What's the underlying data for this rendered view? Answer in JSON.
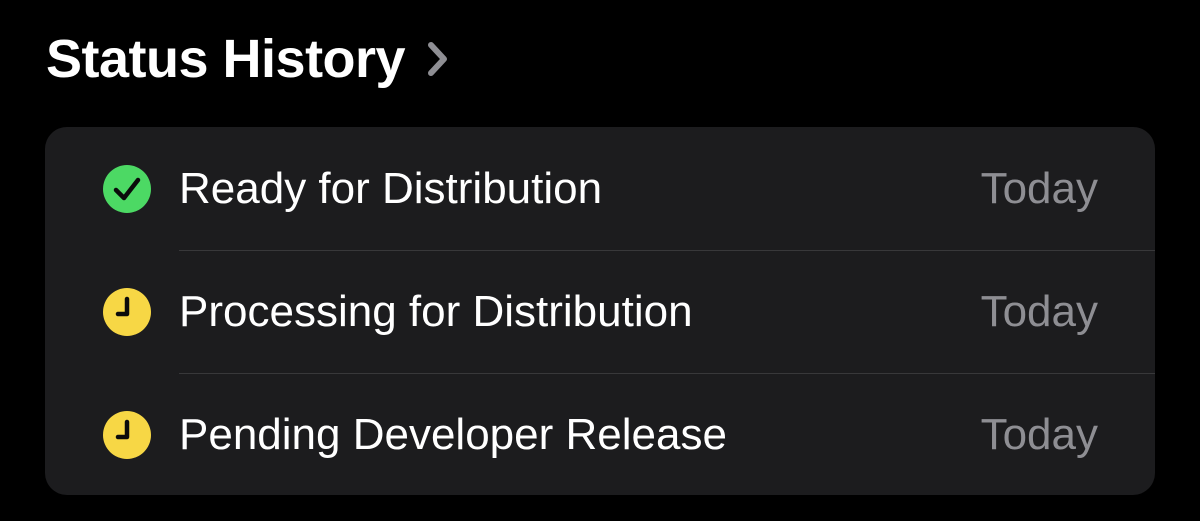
{
  "header": {
    "title": "Status History"
  },
  "colors": {
    "background": "#000000",
    "card": "#1c1c1e",
    "success_green": "#4cd964",
    "pending_yellow": "#f7d745",
    "secondary_text": "#8e8e93"
  },
  "history": {
    "items": [
      {
        "label": "Ready for Distribution",
        "date": "Today",
        "icon": "checkmark-circle-icon",
        "status": "complete"
      },
      {
        "label": "Processing for Distribution",
        "date": "Today",
        "icon": "clock-icon",
        "status": "pending"
      },
      {
        "label": "Pending Developer Release",
        "date": "Today",
        "icon": "clock-icon",
        "status": "pending"
      }
    ]
  }
}
